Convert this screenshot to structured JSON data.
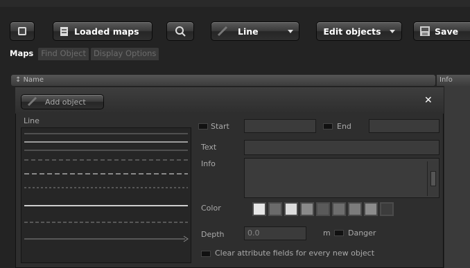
{
  "toolbar": {
    "loaded_maps": "Loaded maps",
    "line": "Line",
    "edit_objects": "Edit objects",
    "save": "Save"
  },
  "tabs": [
    {
      "label": "Maps",
      "active": true
    },
    {
      "label": "Find Object",
      "active": false
    },
    {
      "label": "Display Options",
      "active": false
    }
  ],
  "table": {
    "name_header": "Name",
    "info_header": "Info"
  },
  "panel": {
    "add_object": "Add object",
    "close": "✕",
    "line_label": "Line",
    "start_label": "Start",
    "end_label": "End",
    "text_label": "Text",
    "info_label": "Info",
    "color_label": "Color",
    "depth_label": "Depth",
    "depth_value": "0.0",
    "depth_unit": "m",
    "danger_label": "Danger",
    "clear_label": "Clear attribute fields for every new object"
  },
  "colors": {
    "accent": "#cfcfcf",
    "swatches": [
      "#e6e6e6",
      "#6a6a6a",
      "#dcdcdc",
      "#8a8a8a",
      "#5a5a5a",
      "#6e6e6e",
      "#7c7c7c",
      "#8c8c8c",
      "#3c3c3c"
    ]
  },
  "icons": {
    "app": "screen-icon",
    "loaded_maps": "maps-icon",
    "zoom": "magnifier-icon",
    "line": "pencil-icon",
    "save": "save-icon",
    "add": "pencil-icon"
  }
}
